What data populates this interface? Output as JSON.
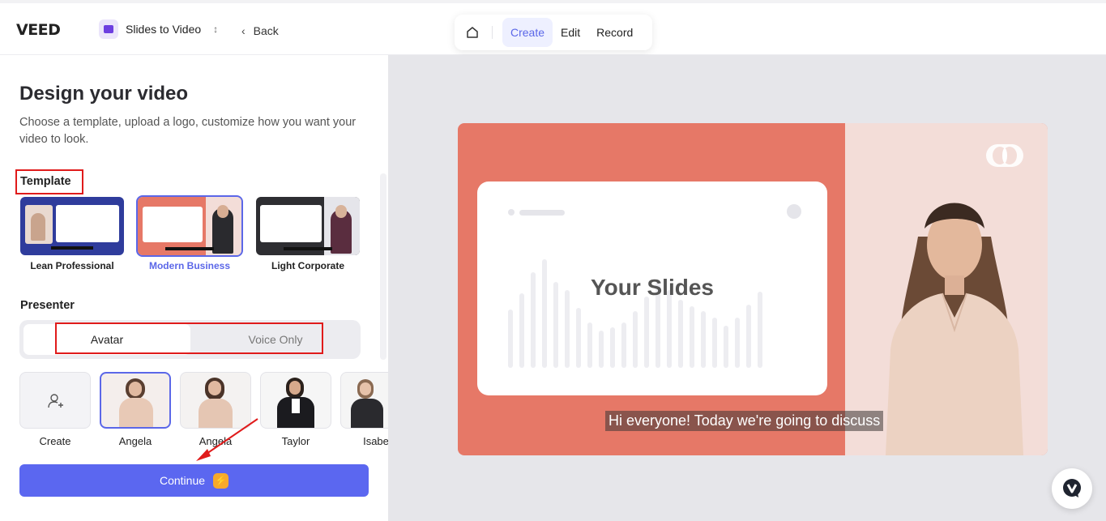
{
  "topbar": {
    "logo": "VEED",
    "project_name": "Slides to Video",
    "back_label": "Back",
    "modes": [
      "Create",
      "Edit",
      "Record"
    ],
    "active_mode": "Create",
    "home_icon": "home-icon"
  },
  "left": {
    "title": "Design your video",
    "subtitle": "Choose a template, upload a logo, customize how you want your video to look.",
    "template_heading": "Template",
    "templates": [
      {
        "name": "Lean Professional",
        "selected": false
      },
      {
        "name": "Modern Business",
        "selected": true
      },
      {
        "name": "Light Corporate",
        "selected": false
      }
    ],
    "presenter_heading": "Presenter",
    "presenter_modes": {
      "avatar": "Avatar",
      "voice_only": "Voice Only",
      "selected": "Avatar"
    },
    "presenters": [
      "Create",
      "Angela",
      "Angela",
      "Taylor",
      "Isabe"
    ],
    "selected_presenter": "Angela",
    "continue_label": "Continue"
  },
  "preview": {
    "slide_title": "Your Slides",
    "caption": "Hi everyone! Today we're going to discuss"
  },
  "colors": {
    "accent": "#5b67f0",
    "preview_coral": "#e67867",
    "annotation_red": "#e01b1b"
  }
}
